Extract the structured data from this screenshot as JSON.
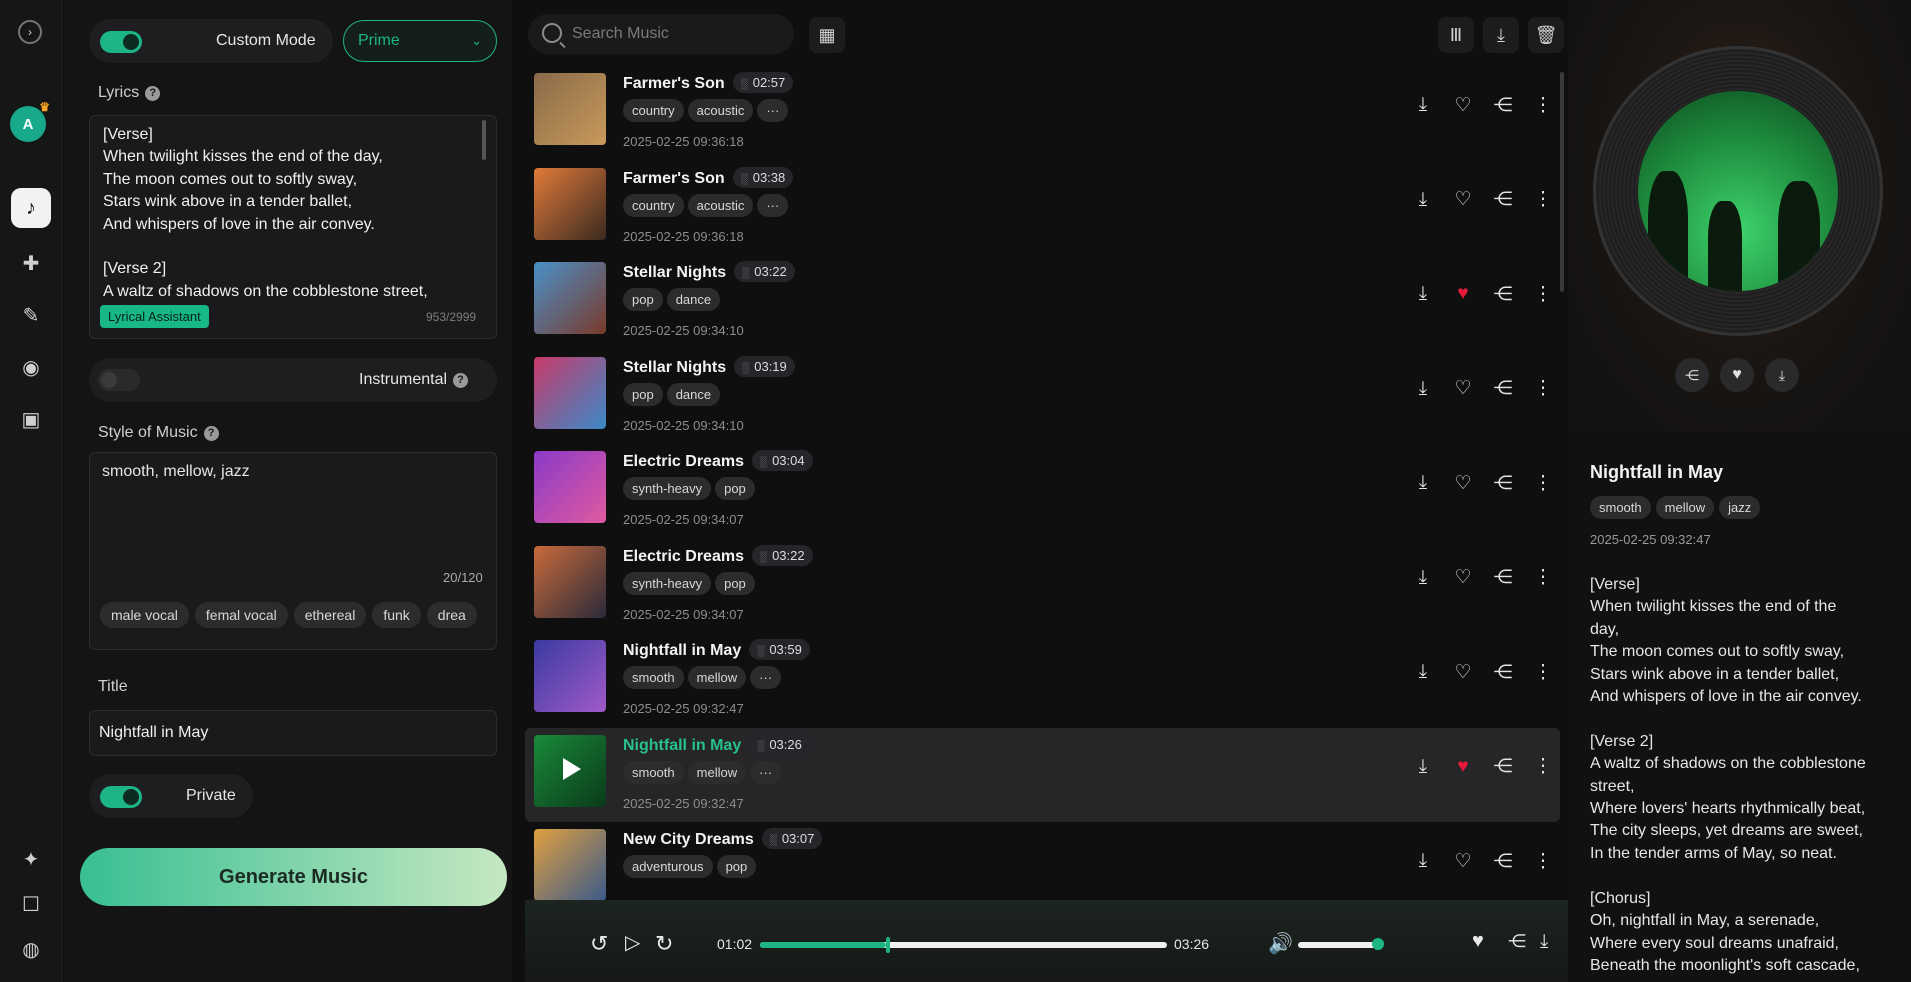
{
  "sidebar": {
    "avatar_letter": "A"
  },
  "left": {
    "custom_mode_label": "Custom Mode",
    "model_select": "Prime",
    "lyrics_label": "Lyrics",
    "lyrics_text": "[Verse]\nWhen twilight kisses the end of the day,\nThe moon comes out to softly sway,\nStars wink above in a tender ballet,\nAnd whispers of love in the air convey.\n\n[Verse 2]\nA waltz of shadows on the cobblestone street,",
    "lyrical_assistant": "Lyrical Assistant",
    "lyrics_count": "953/2999",
    "instrumental_label": "Instrumental",
    "style_label": "Style of Music",
    "style_value": "smooth, mellow, jazz",
    "style_count": "20/120",
    "style_chips": [
      "male vocal",
      "femal vocal",
      "ethereal",
      "funk",
      "drea"
    ],
    "title_label": "Title",
    "title_value": "Nightfall in May",
    "private_label": "Private",
    "generate_label": "Generate Music"
  },
  "search": {
    "placeholder": "Search Music"
  },
  "songs": [
    {
      "name": "Farmer's Son",
      "duration": "02:57",
      "tags": [
        "country",
        "acoustic",
        "···"
      ],
      "date": "2025-02-25 09:36:18",
      "liked": false
    },
    {
      "name": "Farmer's Son",
      "duration": "03:38",
      "tags": [
        "country",
        "acoustic",
        "···"
      ],
      "date": "2025-02-25 09:36:18",
      "liked": false
    },
    {
      "name": "Stellar Nights",
      "duration": "03:22",
      "tags": [
        "pop",
        "dance"
      ],
      "date": "2025-02-25 09:34:10",
      "liked": true
    },
    {
      "name": "Stellar Nights",
      "duration": "03:19",
      "tags": [
        "pop",
        "dance"
      ],
      "date": "2025-02-25 09:34:10",
      "liked": false
    },
    {
      "name": "Electric Dreams",
      "duration": "03:04",
      "tags": [
        "synth-heavy",
        "pop"
      ],
      "date": "2025-02-25 09:34:07",
      "liked": false
    },
    {
      "name": "Electric Dreams",
      "duration": "03:22",
      "tags": [
        "synth-heavy",
        "pop"
      ],
      "date": "2025-02-25 09:34:07",
      "liked": false
    },
    {
      "name": "Nightfall in May",
      "duration": "03:59",
      "tags": [
        "smooth",
        "mellow",
        "···"
      ],
      "date": "2025-02-25 09:32:47",
      "liked": false
    },
    {
      "name": "Nightfall in May",
      "duration": "03:26",
      "tags": [
        "smooth",
        "mellow",
        "···"
      ],
      "date": "2025-02-25 09:32:47",
      "liked": true,
      "selected": true
    },
    {
      "name": "New City Dreams",
      "duration": "03:07",
      "tags": [
        "adventurous",
        "pop"
      ],
      "date": "",
      "liked": false
    }
  ],
  "player": {
    "current": "01:02",
    "total": "03:26",
    "progress": 0.31,
    "volume": 0.9
  },
  "detail": {
    "title": "Nightfall in May",
    "tags": [
      "smooth",
      "mellow",
      "jazz"
    ],
    "date": "2025-02-25 09:32:47",
    "lyrics": "[Verse]\nWhen twilight kisses the end of the\nday,\nThe moon comes out to softly sway,\nStars wink above in a tender ballet,\nAnd whispers of love in the air convey.\n\n[Verse 2]\nA waltz of shadows on the cobblestone\nstreet,\nWhere lovers' hearts rhythmically beat,\nThe city sleeps, yet dreams are sweet,\nIn the tender arms of May, so neat.\n\n[Chorus]\nOh, nightfall in May, a serenade,\nWhere every soul dreams unafraid,\nBeneath the moonlight's soft cascade,"
  },
  "colors": {
    "accent": "#1db486",
    "heart": "#e8193c"
  },
  "icons": [
    "expand-icon",
    "music-note-icon",
    "create-icon",
    "lyrics-icon",
    "voice-icon",
    "video-icon",
    "sparkle-icon",
    "chat-icon",
    "globe-icon"
  ]
}
